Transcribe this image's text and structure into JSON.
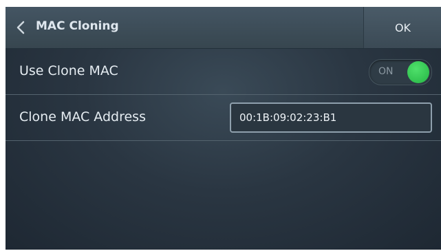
{
  "header": {
    "title": "MAC Cloning",
    "ok_label": "OK",
    "back_icon": "chevron-left-icon"
  },
  "rows": {
    "use_clone_mac": {
      "label": "Use Clone MAC",
      "toggle_text": "ON",
      "toggle_state": true,
      "toggle_color": "#2fc24d"
    },
    "clone_mac_address": {
      "label": "Clone MAC Address",
      "value": "00:1B:09:02:23:B1"
    }
  }
}
